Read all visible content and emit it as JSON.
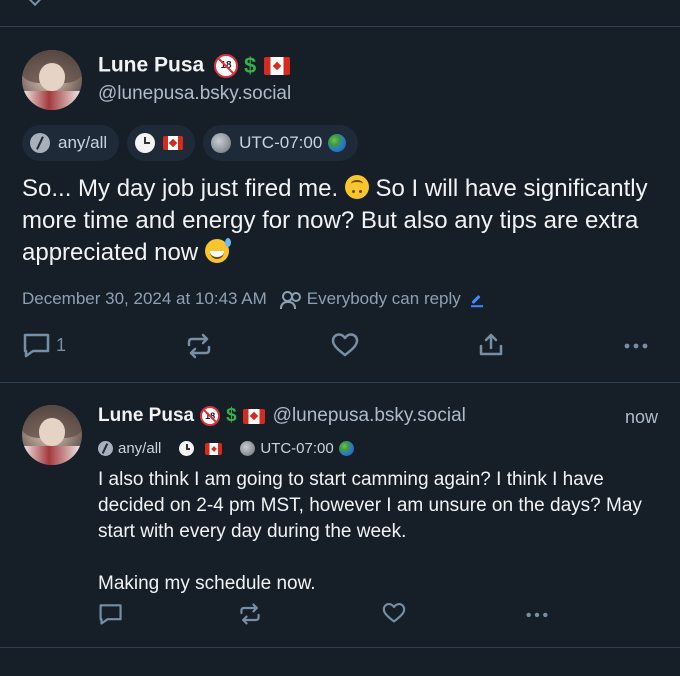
{
  "main_post": {
    "author": {
      "display_name": "Lune Pusa",
      "handle": "@lunepusa.bsky.social",
      "name_emojis": [
        "no-under-18",
        "dollar-sign",
        "flag-canada"
      ]
    },
    "labels": [
      {
        "icon": "slash-circle-icon",
        "text": "any/all"
      },
      {
        "icon": "clock-icon",
        "text": ""
      },
      {
        "icon": "moon-icon",
        "text": "UTC-07:00"
      }
    ],
    "text_line1": "So... My day job just fired me. ",
    "text_line1b": " So I will have significantly more time and energy for now? But also any tips are extra appreciated now ",
    "timestamp": "December 30, 2024 at 10:43 AM",
    "reply_setting": "Everybody can reply",
    "reply_count": "1"
  },
  "reply_post": {
    "author": {
      "display_name": "Lune Pusa",
      "handle": "@lunepusa.bsky.social"
    },
    "timestamp": "now",
    "labels": [
      {
        "icon": "slash-circle-icon",
        "text": "any/all"
      },
      {
        "icon": "clock-icon",
        "text": ""
      },
      {
        "icon": "moon-icon",
        "text": "UTC-07:00"
      }
    ],
    "text": "I also think I am going to start camming again? I think I have decided on 2-4 pm MST, however I am unsure on the days? May start with every day during the week.\n\nMaking my schedule now."
  },
  "colors": {
    "background": "#161e27",
    "divider": "#2e4052",
    "text_primary": "#f1f3f5",
    "text_secondary": "#aebbc9",
    "icon": "#788ea5",
    "accent": "#3d8bff"
  }
}
